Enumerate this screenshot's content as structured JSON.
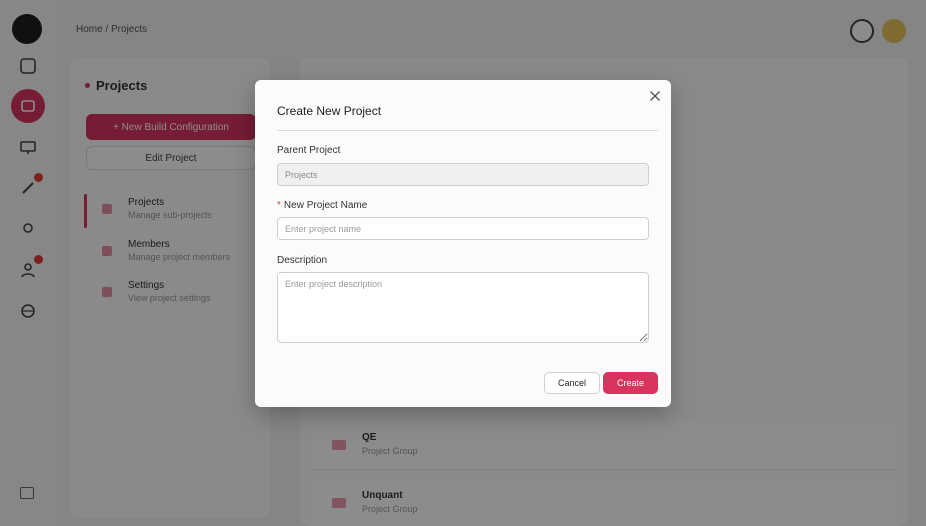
{
  "background": {
    "breadcrumb": "Home / Projects",
    "left_panel": {
      "title": "Projects",
      "primary_button": "+ New Build Configuration",
      "secondary_button": "Edit Project",
      "nav": [
        {
          "title": "Projects",
          "subtitle": "Manage sub-projects"
        },
        {
          "title": "Members",
          "subtitle": "Manage project members"
        },
        {
          "title": "Settings",
          "subtitle": "View project settings"
        }
      ]
    },
    "rows": [
      {
        "name": "QE",
        "type": "Project Group"
      },
      {
        "name": "Unquant",
        "type": "Project Group"
      }
    ],
    "accent_color": "#d8345f"
  },
  "modal": {
    "title": "Create New Project",
    "parent_label": "Parent Project",
    "parent_value": "Projects",
    "name_label": "New Project Name",
    "name_required_mark": "*",
    "name_placeholder": "Enter project name",
    "description_label": "Description",
    "description_placeholder": "Enter project description",
    "cancel_label": "Cancel",
    "create_label": "Create",
    "close_icon": "close-icon"
  }
}
